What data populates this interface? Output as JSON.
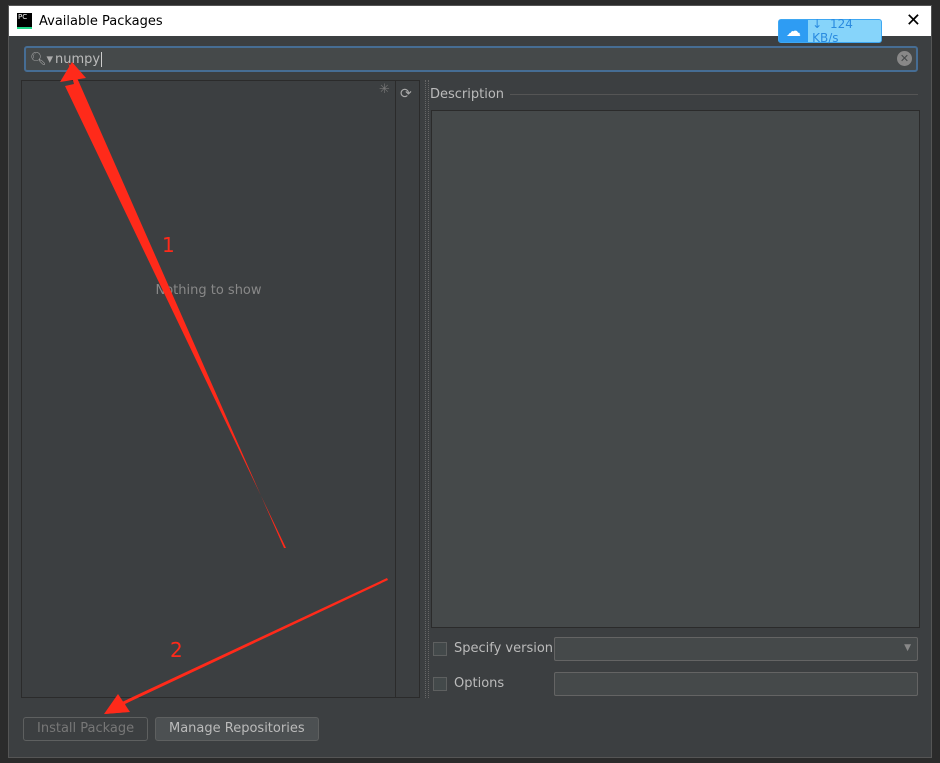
{
  "dialog": {
    "title": "Available Packages",
    "close": "✕"
  },
  "overlay": {
    "speed": "124 KB/s",
    "icon": "cloud-download-icon"
  },
  "search": {
    "value": "numpy",
    "icon": "search-icon"
  },
  "list": {
    "empty_text": "Nothing to show"
  },
  "description": {
    "label": "Description"
  },
  "options": {
    "specify_version": "Specify version",
    "options": "Options",
    "specify_version_checked": false,
    "options_checked": false
  },
  "buttons": {
    "install": "Install Package",
    "manage": "Manage Repositories"
  },
  "annotations": {
    "step1": "1",
    "step2": "2",
    "color": "#ff2a1a"
  }
}
